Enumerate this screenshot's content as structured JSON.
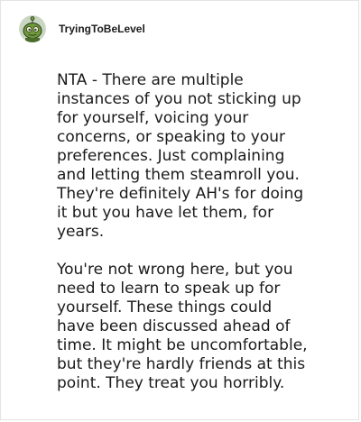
{
  "comment": {
    "username": "TryingToBeLevel",
    "avatar_icon": "snoo-avatar-icon",
    "paragraphs": [
      [
        "NTA - There are multiple",
        "instances of you not sticking up",
        "for yourself, voicing your",
        "concerns, or speaking to your",
        "preferences. Just complaining",
        "and letting them steamroll you.",
        "They're definitely AH's for doing",
        "it but you have let them, for",
        "years."
      ],
      [
        "You're not wrong here, but you",
        "need to learn to speak up for",
        "yourself. These things could",
        "have been discussed ahead of",
        "time. It might be uncomfortable,",
        "but they're hardly friends at this",
        "point. They treat you horribly."
      ]
    ]
  },
  "colors": {
    "text": "#1a1a1b",
    "border": "#e3e3e3",
    "avatar_bg": "#c9d6c2",
    "avatar_face": "#6e9a3a"
  }
}
